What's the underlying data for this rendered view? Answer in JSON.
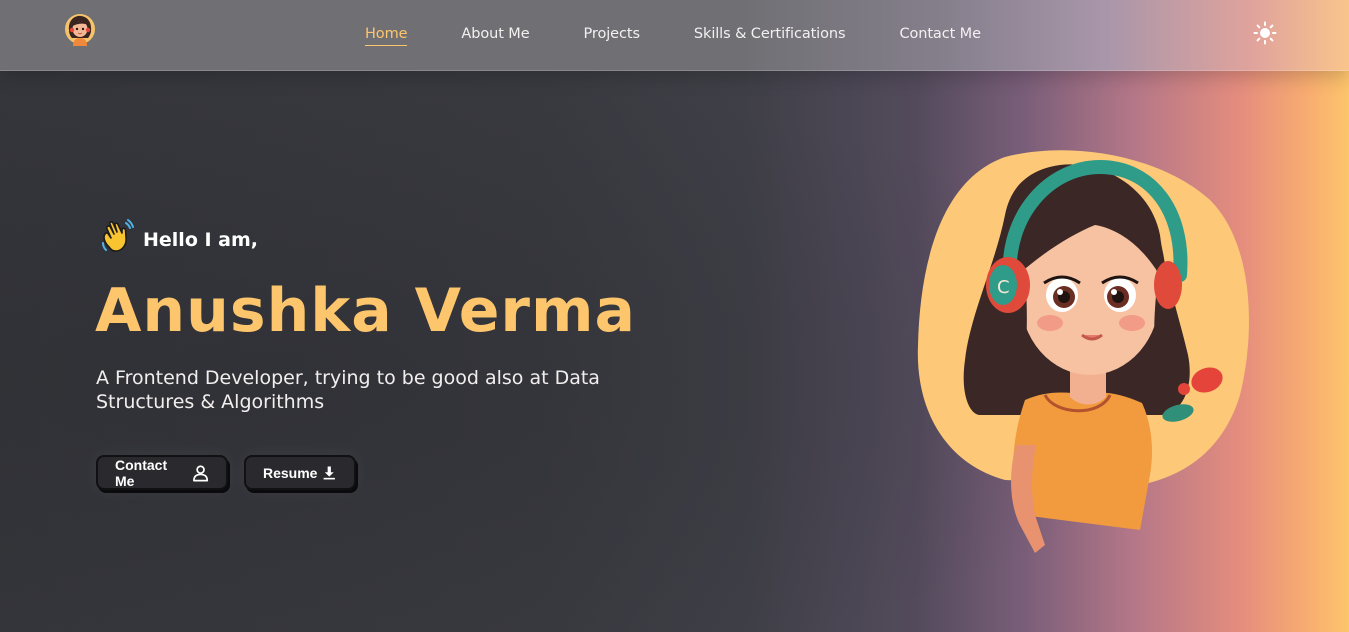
{
  "navbar": {
    "links": [
      {
        "label": "Home",
        "active": true
      },
      {
        "label": "About Me",
        "active": false
      },
      {
        "label": "Projects",
        "active": false
      },
      {
        "label": "Skills & Certifications",
        "active": false
      },
      {
        "label": "Contact Me",
        "active": false
      }
    ],
    "logo_icon": "girl-avatar-logo",
    "theme_toggle_icon": "sun-icon"
  },
  "hero": {
    "greeting_icon": "waving-hand-icon",
    "greeting": "Hello I am,",
    "name": "Anushka Verma",
    "tagline": "A Frontend Developer, trying to be good also at Data Structures & Algorithms",
    "buttons": {
      "contact_label": "Contact Me",
      "contact_icon": "user-icon",
      "resume_label": "Resume",
      "resume_icon": "download-icon"
    },
    "avatar_image": "girl-with-headphones-illustration"
  },
  "colors": {
    "accent": "#fdc56c",
    "background_dark": "#35363b",
    "gradient_end": "#fdc56c",
    "button_bg": "#2a2a2e"
  }
}
